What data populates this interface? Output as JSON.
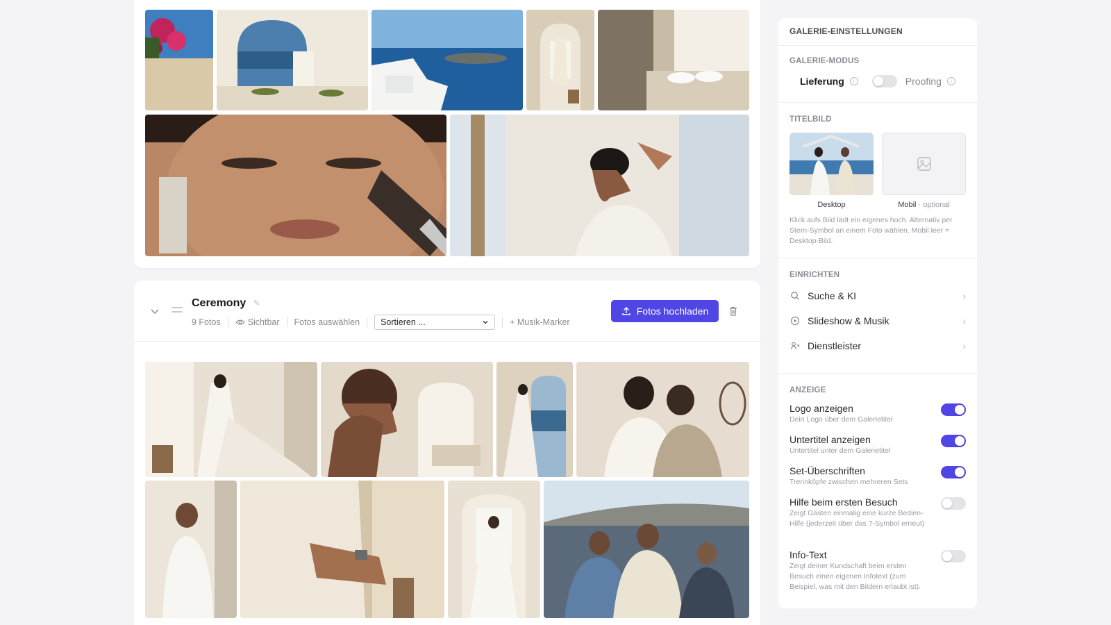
{
  "colors": {
    "accent": "#4f46e5"
  },
  "top_set": {
    "photos": [
      {
        "name": "bougainvillea"
      },
      {
        "name": "arch-sea"
      },
      {
        "name": "santorini-view"
      },
      {
        "name": "dress-hanging"
      },
      {
        "name": "shoes-window"
      },
      {
        "name": "makeup-closeup"
      },
      {
        "name": "bride-hair"
      }
    ]
  },
  "ceremony": {
    "title": "Ceremony",
    "count": "9 Fotos",
    "visibility": "Sichtbar",
    "select_photos": "Fotos auswählen",
    "sort_placeholder": "Sortieren ...",
    "music_marker": "+ Musik-Marker",
    "upload_label": "Fotos hochladen"
  },
  "panel": {
    "title": "GALERIE-EINSTELLUNGEN",
    "mode": {
      "label": "GALERIE-MODUS",
      "option_left": "Lieferung",
      "option_right": "Proofing"
    },
    "cover": {
      "label": "TITELBILD",
      "desktop": "Desktop",
      "mobile": "Mobil",
      "mobile_optional": " · optional",
      "help": "Klick aufs Bild lädt ein eigenes hoch. Alternativ per Stern-Symbol an einem Foto wählen. Mobil leer = Desktop-Bild."
    },
    "setup": {
      "label": "EINRICHTEN",
      "items": [
        {
          "label": "Suche & KI",
          "icon": "search-icon"
        },
        {
          "label": "Slideshow & Musik",
          "icon": "play-circle-icon"
        },
        {
          "label": "Dienstleister",
          "icon": "vendor-icon"
        }
      ]
    },
    "display": {
      "label": "ANZEIGE",
      "items": [
        {
          "title": "Logo anzeigen",
          "desc": "Dein Logo über dem Galerietitel",
          "on": true
        },
        {
          "title": "Untertitel anzeigen",
          "desc": "Untertitel unter dem Galerietitel",
          "on": true
        },
        {
          "title": "Set-Überschriften",
          "desc": "Trennköpfe zwischen mehreren Sets",
          "on": true
        },
        {
          "title": "Hilfe beim ersten Besuch",
          "desc": "Zeigt Gästen einmalig eine kurze Bedien-Hilfe (jederzeit über das ?-Symbol erneut)",
          "on": false
        },
        {
          "title": "Info-Text",
          "desc": "Zeigt deiner Kundschaft beim ersten Besuch einen eigenen Infotext (zum Beispiel, was mit den Bildern erlaubt ist).",
          "on": false
        }
      ]
    }
  }
}
